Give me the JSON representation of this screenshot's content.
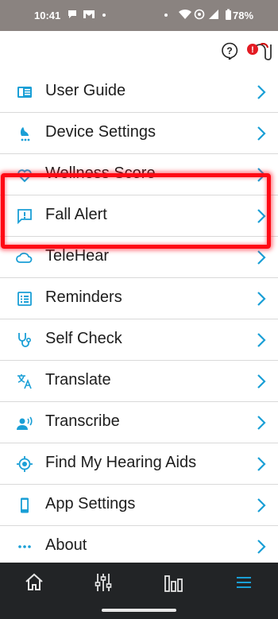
{
  "status_bar": {
    "time": "10:41",
    "battery": "78%"
  },
  "menu_items": [
    {
      "label": "User Guide",
      "icon": "book-icon"
    },
    {
      "label": "Device Settings",
      "icon": "device-settings-icon"
    },
    {
      "label": "Wellness Score",
      "icon": "heart-icon"
    },
    {
      "label": "Fall Alert",
      "icon": "alert-chat-icon"
    },
    {
      "label": "TeleHear",
      "icon": "cloud-icon"
    },
    {
      "label": "Reminders",
      "icon": "list-icon"
    },
    {
      "label": "Self Check",
      "icon": "stethoscope-icon"
    },
    {
      "label": "Translate",
      "icon": "translate-icon"
    },
    {
      "label": "Transcribe",
      "icon": "speaker-person-icon"
    },
    {
      "label": "Find My Hearing Aids",
      "icon": "locate-icon"
    },
    {
      "label": "App Settings",
      "icon": "phone-icon"
    },
    {
      "label": "About",
      "icon": "more-dots-icon"
    }
  ],
  "colors": {
    "accent": "#1a9fd6",
    "highlight": "#ff0a14",
    "status_bar": "#8a8380",
    "tab_bar": "#222426"
  },
  "tab_bar": {
    "tabs": [
      "home-icon",
      "sliders-icon",
      "bar-chart-icon",
      "menu-icon"
    ],
    "active": "menu-icon"
  }
}
